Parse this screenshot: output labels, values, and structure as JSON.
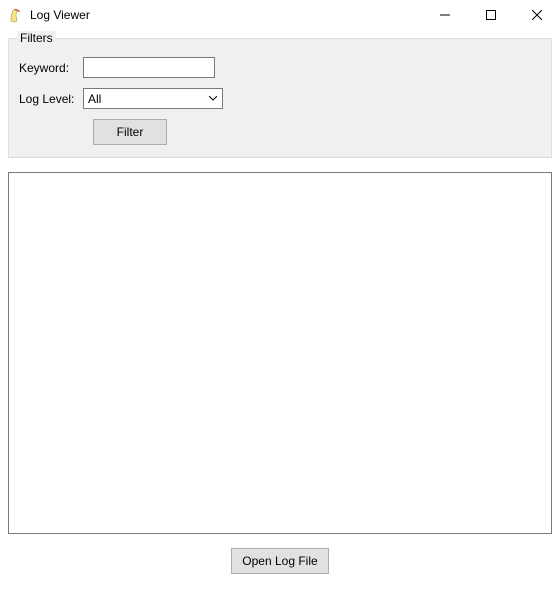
{
  "window": {
    "title": "Log Viewer"
  },
  "filters": {
    "group_title": "Filters",
    "keyword_label": "Keyword:",
    "keyword_value": "",
    "loglevel_label": "Log Level:",
    "loglevel_selected": "All",
    "filter_button": "Filter"
  },
  "log_area": {
    "content": ""
  },
  "footer": {
    "open_button": "Open Log File"
  }
}
